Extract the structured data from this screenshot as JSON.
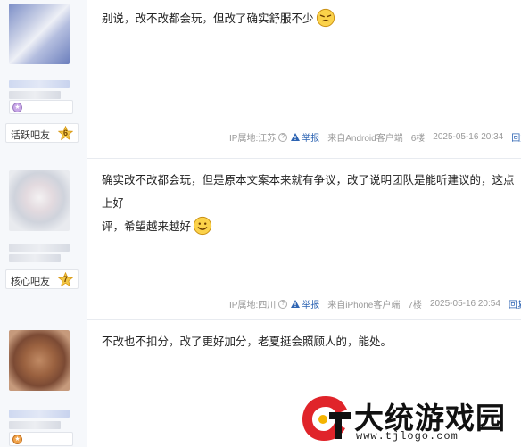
{
  "posts": [
    {
      "content": "别说，改不改都会玩，但改了确实舒服不少",
      "emoji": "smirk-emoji",
      "level_name": "活跃吧友",
      "level_num": "6",
      "ip_label": "IP属地:江苏",
      "report_label": "举报",
      "source": "来自Android客户端",
      "floor": "6楼",
      "time": "2025-05-16 20:34",
      "reply_label": "回复"
    },
    {
      "content_line1": "确实改不改都会玩，但是原本文案本来就有争议，改了说明团队是能听建议的，这点上好",
      "content_line2": "评，希望越来越好",
      "emoji": "smile-emoji",
      "level_name": "核心吧友",
      "level_num": "7",
      "ip_label": "IP属地:四川",
      "report_label": "举报",
      "source": "来自iPhone客户端",
      "floor": "7楼",
      "time": "2025-05-16 20:54",
      "reply_label": "回复"
    },
    {
      "content": "不改也不扣分，改了更好加分，老夏挺会照顾人的，能处。"
    }
  ],
  "watermark": {
    "title": "大统游戏园",
    "url": "www.tjlogo.com"
  },
  "colors": {
    "link_blue": "#2d64b3",
    "meta_gray": "#999999",
    "side_bg": "#f6f8fb"
  }
}
